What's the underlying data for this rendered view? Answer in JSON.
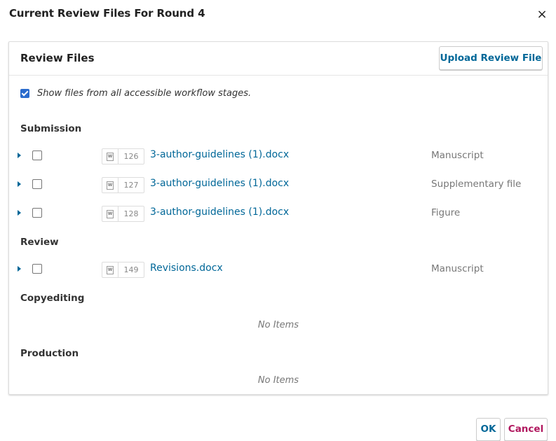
{
  "modal": {
    "title": "Current Review Files For Round 4",
    "close_icon": "×"
  },
  "panel": {
    "title": "Review Files",
    "upload_label": "Upload Review File",
    "show_all_label": "Show files from all accessible workflow stages.",
    "show_all_checked": true
  },
  "groups": [
    {
      "title": "Submission",
      "files": [
        {
          "id": "126",
          "name": "3-author-guidelines (1).docx",
          "genre": "Manuscript"
        },
        {
          "id": "127",
          "name": "3-author-guidelines (1).docx",
          "genre": "Supplementary file"
        },
        {
          "id": "128",
          "name": "3-author-guidelines (1).docx",
          "genre": "Figure"
        }
      ]
    },
    {
      "title": "Review",
      "files": [
        {
          "id": "149",
          "name": "Revisions.docx",
          "genre": "Manuscript"
        }
      ]
    },
    {
      "title": "Copyediting",
      "empty_label": "No Items"
    },
    {
      "title": "Production",
      "empty_label": "No Items"
    }
  ],
  "footer": {
    "ok_label": "OK",
    "cancel_label": "Cancel"
  },
  "icons": {
    "file_type": "word-doc-icon",
    "expander": "triangle-right-icon"
  },
  "colors": {
    "link": "#006798",
    "cancel": "#b1185f",
    "checkbox": "#2b6ccd"
  }
}
